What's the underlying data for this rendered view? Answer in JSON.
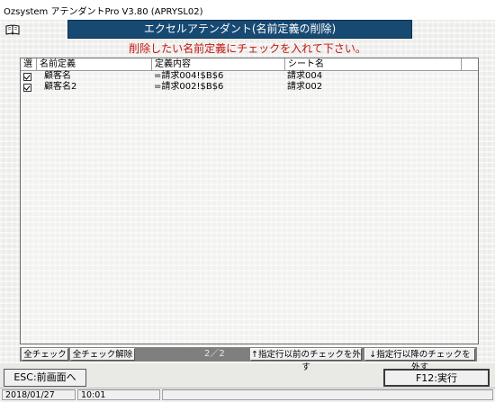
{
  "window": {
    "title": "Ozsystem アテンダントPro V3.80 (APRYSL02)"
  },
  "header": {
    "title": "エクセルアテンダント(名前定義の削除)"
  },
  "subtitle": "削除したい名前定義にチェックを入れて下さい。",
  "table": {
    "columns": [
      "選",
      "名前定義",
      "定義内容",
      "シート名"
    ],
    "rows": [
      {
        "checked": true,
        "name": "顧客名",
        "definition": "=請求004!$B$6",
        "sheet": "請求004"
      },
      {
        "checked": true,
        "name": "顧客名2",
        "definition": "=請求002!$B$6",
        "sheet": "請求002"
      }
    ]
  },
  "bottom_bar": {
    "select_all": "全チェック",
    "clear_all": "全チェック解除",
    "page": "2／2",
    "uncheck_before": "↑指定行以前のチェックを外す",
    "uncheck_after": "↓指定行以降のチェックを外す"
  },
  "buttons": {
    "back": "ESC:前画面へ",
    "execute": "F12:実行"
  },
  "status": {
    "date": "2018/01/27",
    "time": "10:01"
  },
  "colors": {
    "header_bg": "#174a73",
    "subtitle": "#c2160e"
  },
  "icons": {
    "book": "book-icon"
  }
}
